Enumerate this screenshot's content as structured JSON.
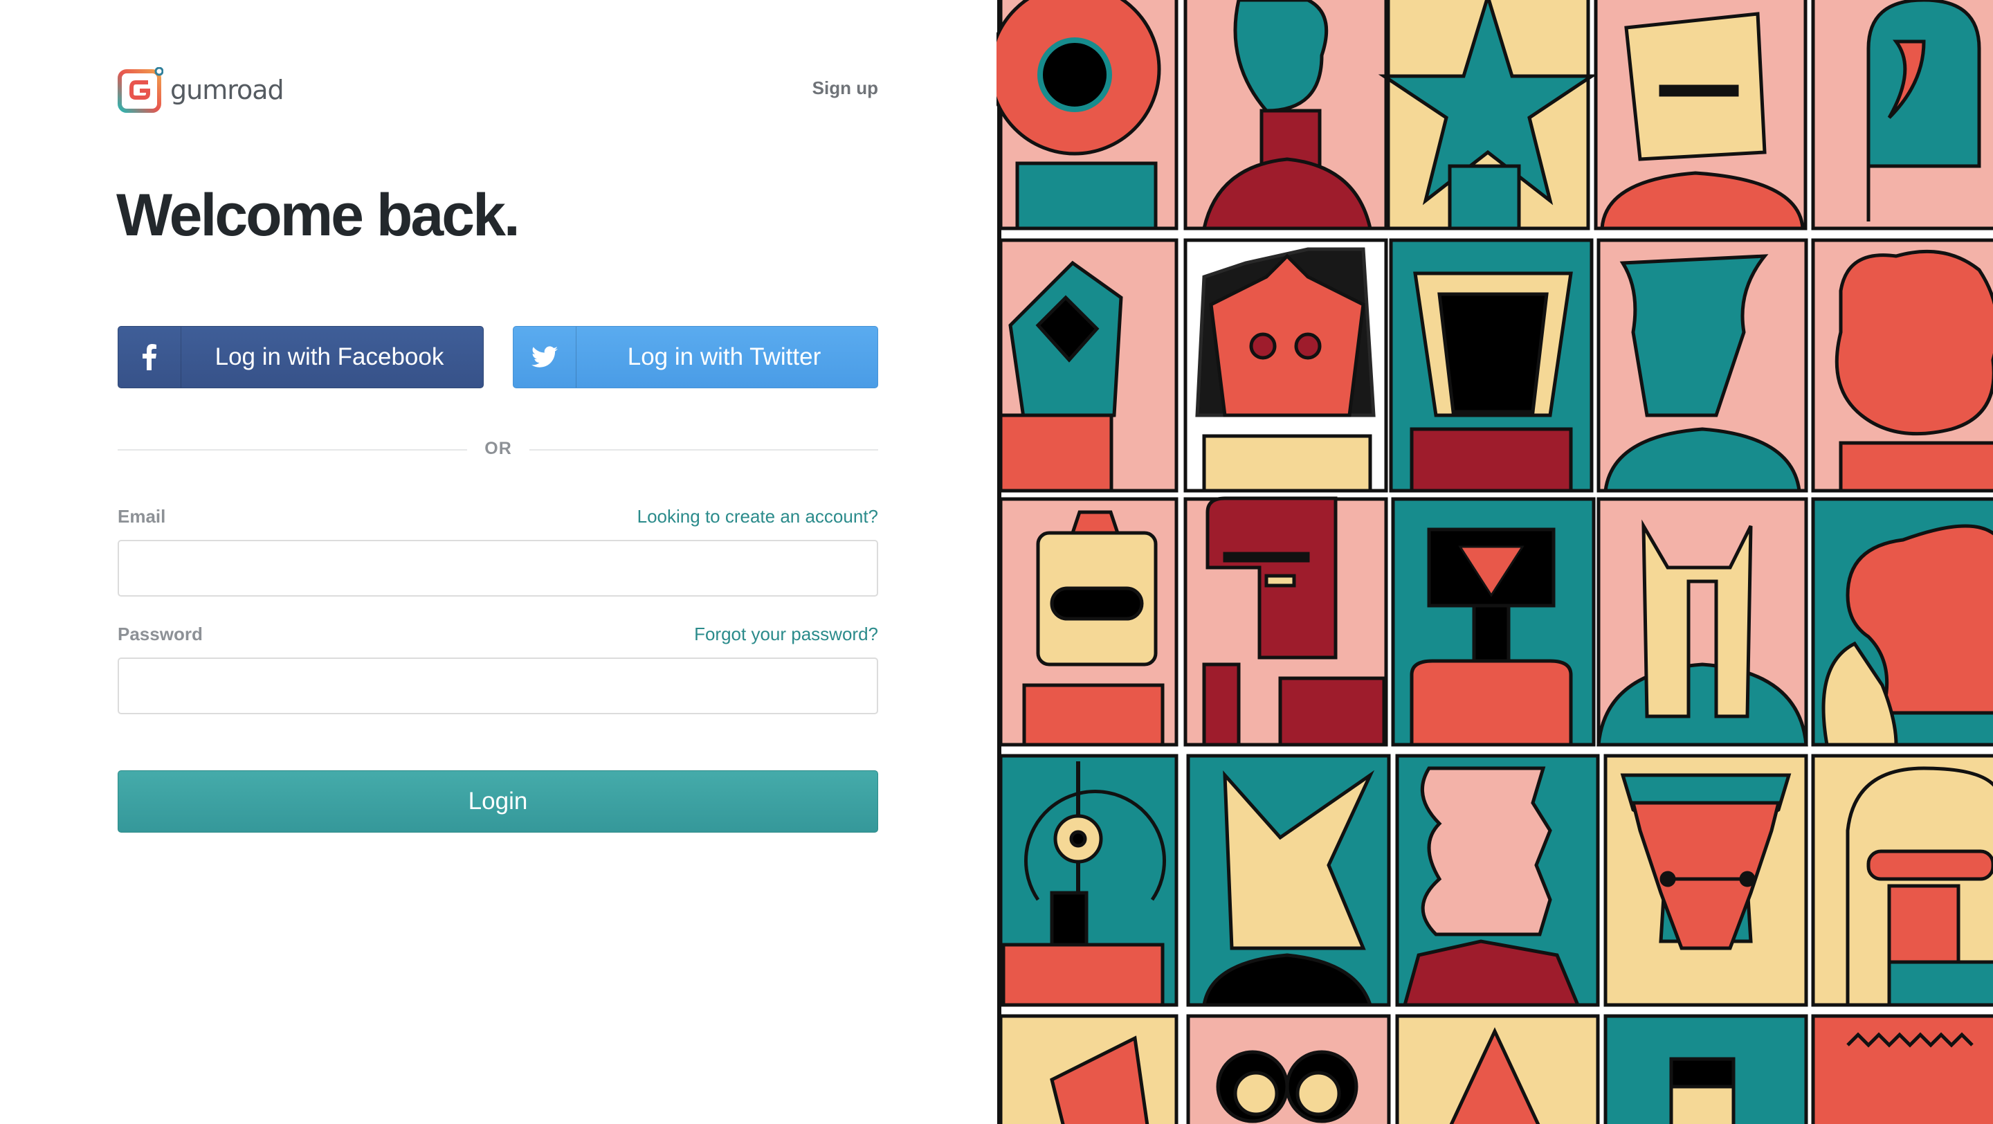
{
  "brand": {
    "name": "gumroad",
    "logo_icon": "gumroad-logo-icon"
  },
  "header": {
    "signup_label": "Sign up"
  },
  "heading": "Welcome back.",
  "social": {
    "facebook_label": "Log in with Facebook",
    "facebook_icon": "facebook-icon",
    "twitter_label": "Log in with Twitter",
    "twitter_icon": "twitter-icon"
  },
  "divider_text": "OR",
  "form": {
    "email_label": "Email",
    "email_link": "Looking to create an account?",
    "email_value": "",
    "password_label": "Password",
    "password_link": "Forgot your password?",
    "password_value": "",
    "submit_label": "Login"
  },
  "colors": {
    "facebook": "#3b5998",
    "twitter": "#55acee",
    "accent": "#3aa0a0",
    "heading": "#23282c",
    "link": "#2b8b8b"
  },
  "artwork": {
    "description_icon": "illustrated-portraits-grid"
  }
}
